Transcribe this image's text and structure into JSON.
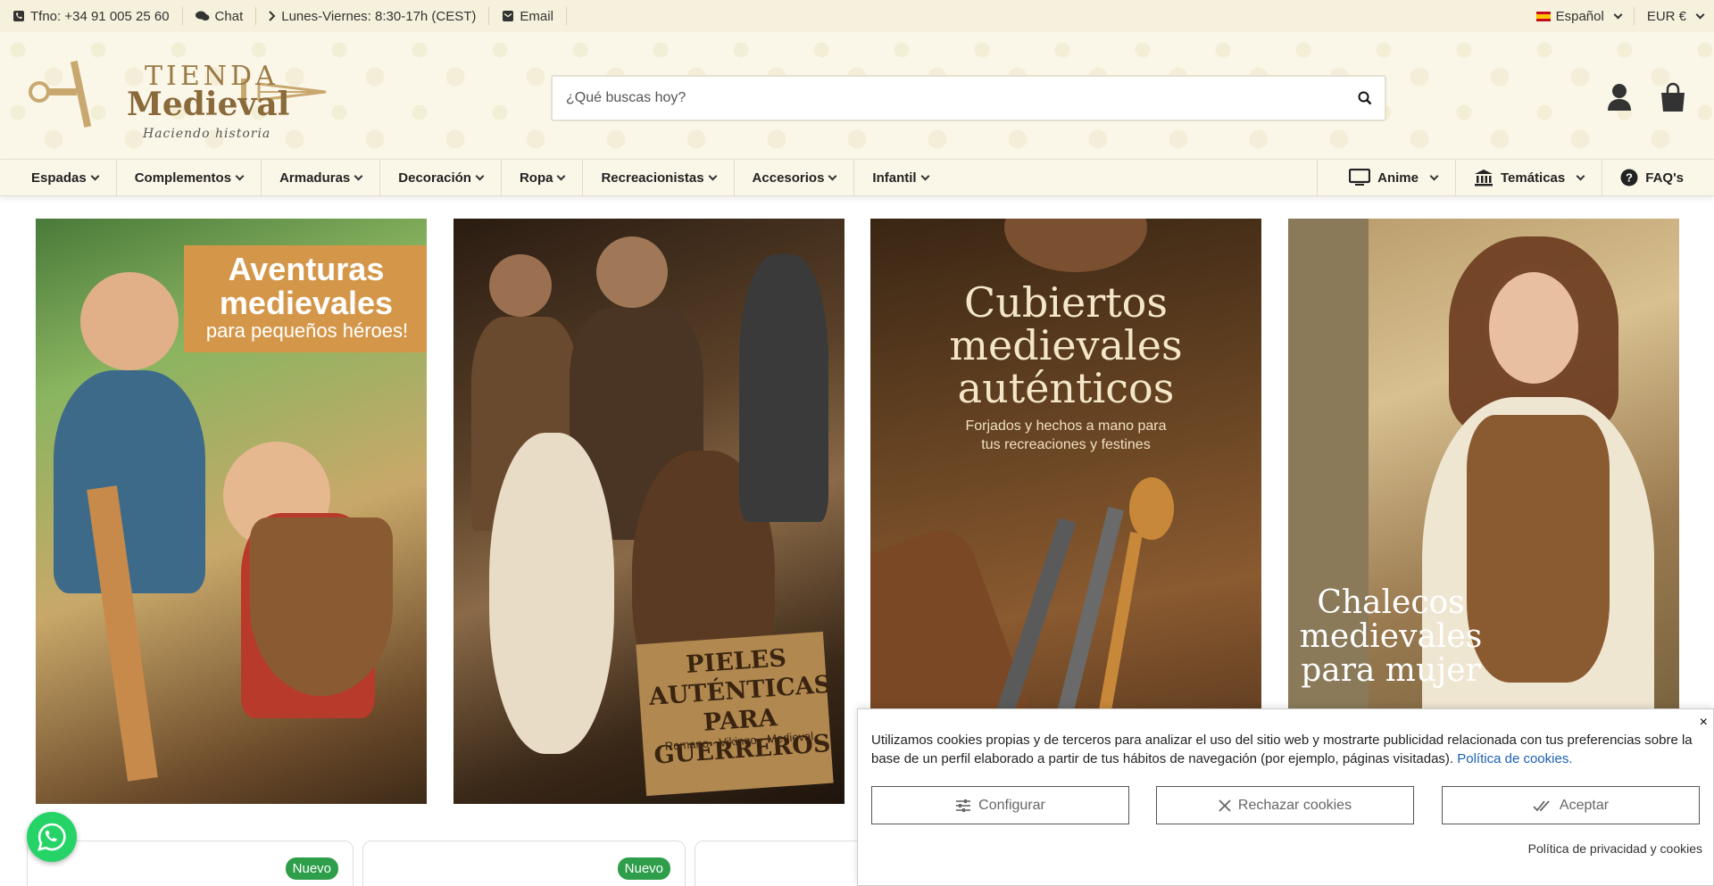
{
  "topbar": {
    "phone": "Tfno: +34 91 005 25 60",
    "chat": "Chat",
    "hours": "Lunes-Viernes: 8:30-17h (CEST)",
    "email": "Email",
    "language": "Español",
    "currency": "EUR €"
  },
  "logo": {
    "line1": "TIENDA",
    "line2": "Medieval",
    "tagline": "Haciendo historia"
  },
  "search": {
    "placeholder": "¿Qué buscas hoy?"
  },
  "nav": {
    "items": [
      "Espadas",
      "Complementos",
      "Armaduras",
      "Decoración",
      "Ropa",
      "Recreacionistas",
      "Accesorios",
      "Infantil"
    ],
    "right": [
      "Anime",
      "Temáticas",
      "FAQ's"
    ]
  },
  "banners": [
    {
      "title": "Aventuras medievales",
      "subtitle": "para pequeños héroes!"
    },
    {
      "title": "PIELES AUTÉNTICAS PARA GUERREROS",
      "subtitle": "Romano · Vikingo · Medieval"
    },
    {
      "title": "Cubiertos medievales auténticos",
      "subtitle": "Forjados y hechos a mano para tus recreaciones y festines"
    },
    {
      "title": "Chalecos medievales para mujer"
    }
  ],
  "products": {
    "badge": "Nuevo"
  },
  "cookie": {
    "message": "Utilizamos cookies propias y de terceros para analizar el uso del sitio web y mostrarte publicidad relacionada con tus preferencias sobre la base de un perfil elaborado a partir de tus hábitos de navegación (por ejemplo, páginas visitadas).",
    "policy_link": "Política de cookies.",
    "configure": "Configurar",
    "reject": "Rechazar cookies",
    "accept": "Aceptar",
    "privacy": "Política de privacidad y cookies",
    "close": "×"
  },
  "colors": {
    "topbar_bg": "#f6f1dc",
    "header_bg": "#fbf7e8",
    "badge_green": "#2e9e4a",
    "whatsapp": "#25d366",
    "logo_brown": "#8a6a3a"
  },
  "icons": [
    "phone-icon",
    "chat-icon",
    "chevron-right-icon",
    "email-icon",
    "search-icon",
    "user-icon",
    "bag-icon",
    "monitor-icon",
    "museum-icon",
    "help-icon",
    "whatsapp-icon",
    "sliders-icon",
    "x-icon",
    "double-check-icon"
  ]
}
